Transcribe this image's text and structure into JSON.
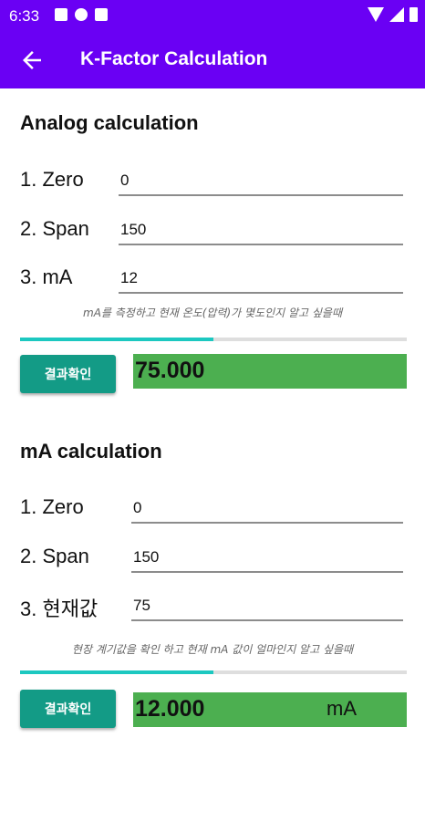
{
  "status_bar": {
    "time": "6:33"
  },
  "app_bar": {
    "title": "K-Factor Calculation"
  },
  "analog": {
    "title": "Analog calculation",
    "zero_label": "1. Zero",
    "zero_value": "0",
    "span_label": "2. Span",
    "span_value": "150",
    "ma_label": "3. mA",
    "ma_value": "12",
    "hint": "mA를 측정하고 현재 온도(압력)가 몇도인지 알고 싶을때",
    "progress": 0.5,
    "button": "결과확인",
    "result": "75.000"
  },
  "ma": {
    "title": "mA calculation",
    "zero_label": "1. Zero",
    "zero_value": "0",
    "span_label": "2. Span",
    "span_value": "150",
    "current_label": "3. 현재값",
    "current_value": "75",
    "hint": "현장 계기값을 확인 하고 현재 mA 값이 얼마인지 알고 싶을때",
    "progress": 0.5,
    "button": "결과확인",
    "result": "12.000",
    "unit": "mA"
  },
  "colors": {
    "primary": "#6a00f4",
    "button": "#139b86",
    "result_bg": "#4caf50",
    "progress": "#1cc8c0"
  }
}
